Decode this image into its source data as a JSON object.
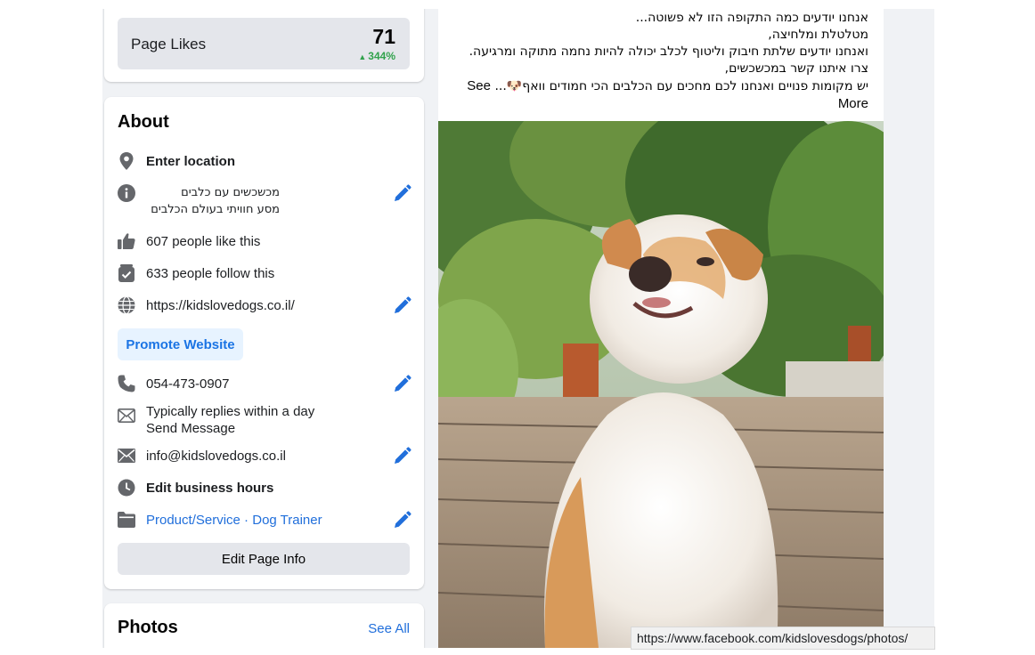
{
  "page_likes": {
    "label": "Page Likes",
    "count": "71",
    "trend": "344%",
    "trend_color": "#31a24c"
  },
  "about": {
    "title": "About",
    "location": "Enter location",
    "description_line1": "מכשכשים עם כלבים",
    "description_line2": "מסע חוויתי בעולם הכלבים",
    "likes_text": "607 people like this",
    "follow_text": "633 people follow this",
    "website": "https://kidslovedogs.co.il/",
    "promote_label": "Promote Website",
    "phone": "054-473-0907",
    "reply_time": "Typically replies within a day",
    "send_message": "Send Message",
    "email": "info@kidslovedogs.co.il",
    "hours": "Edit business hours",
    "category_1": "Product/Service",
    "category_sep": " · ",
    "category_2": "Dog Trainer",
    "edit_label": "Edit Page Info"
  },
  "photos": {
    "title": "Photos",
    "see_all": "See All"
  },
  "post": {
    "line1": "אנחנו יודעים כמה התקופה הזו לא פשוטה...",
    "line2": "מטלטלת ומלחיצה,",
    "line3": "ואנחנו יודעים שלתת חיבוק וליטוף לכלב יכולה להיות נחמה מתוקה ומרגיעה.",
    "line4": "צרו איתנו קשר במכשכשים,",
    "line5": "יש מקומות פנויים ואנחנו לכם מחכים עם הכלבים הכי חמודים וואף🐶...",
    "see": "See",
    "more": "More"
  },
  "status_url": "https://www.facebook.com/kidslovesdogs/photos/",
  "colors": {
    "link": "#216fdb",
    "accent_blue": "#1b74e4",
    "page_bg": "#f0f2f5",
    "icon_gray": "#65676b"
  },
  "icons": [
    "location-pin-icon",
    "info-icon",
    "thumbs-up-icon",
    "follow-icon",
    "globe-icon",
    "phone-icon",
    "messenger-icon",
    "envelope-icon",
    "clock-icon",
    "category-icon",
    "pencil-icon"
  ]
}
